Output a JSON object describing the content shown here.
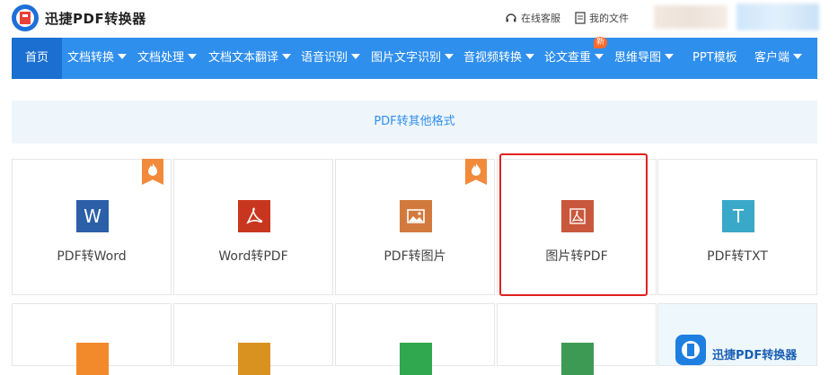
{
  "header": {
    "brand": "迅捷PDF转换器",
    "service_label": "在线客服",
    "files_label": "我的文件"
  },
  "nav": {
    "items": [
      {
        "label": "首页",
        "dropdown": false,
        "active": true
      },
      {
        "label": "文档转换",
        "dropdown": true
      },
      {
        "label": "文档处理",
        "dropdown": true
      },
      {
        "label": "文档文本翻译",
        "dropdown": true
      },
      {
        "label": "语音识别",
        "dropdown": true
      },
      {
        "label": "图片文字识别",
        "dropdown": true
      },
      {
        "label": "音视频转换",
        "dropdown": true
      },
      {
        "label": "论文查重",
        "dropdown": true,
        "badge": "新"
      },
      {
        "label": "思维导图",
        "dropdown": true
      },
      {
        "label": "PPT模板",
        "dropdown": false
      },
      {
        "label": "客户端",
        "dropdown": true
      }
    ]
  },
  "section": {
    "title": "PDF转其他格式"
  },
  "tools": [
    {
      "label": "PDF转Word",
      "icon": "word-icon",
      "icon_text": "W",
      "color": "#2b5fa8",
      "hot": true
    },
    {
      "label": "Word转PDF",
      "icon": "pdf-icon",
      "color": "#c9361f",
      "hot": false
    },
    {
      "label": "PDF转图片",
      "icon": "image-icon",
      "color": "#d27a3e",
      "hot": true
    },
    {
      "label": "图片转PDF",
      "icon": "pdf-icon",
      "color": "#c9573c",
      "hot": false,
      "selected": true
    },
    {
      "label": "PDF转TXT",
      "icon": "txt-icon",
      "icon_text": "T",
      "color": "#3aa8c9",
      "hot": false
    }
  ],
  "second_row": {
    "icon_colors": [
      "#f28a2b",
      "#d9921f",
      "#2fa84f",
      "#3d9a55"
    ],
    "promo_text": "迅捷PDF转换器"
  }
}
